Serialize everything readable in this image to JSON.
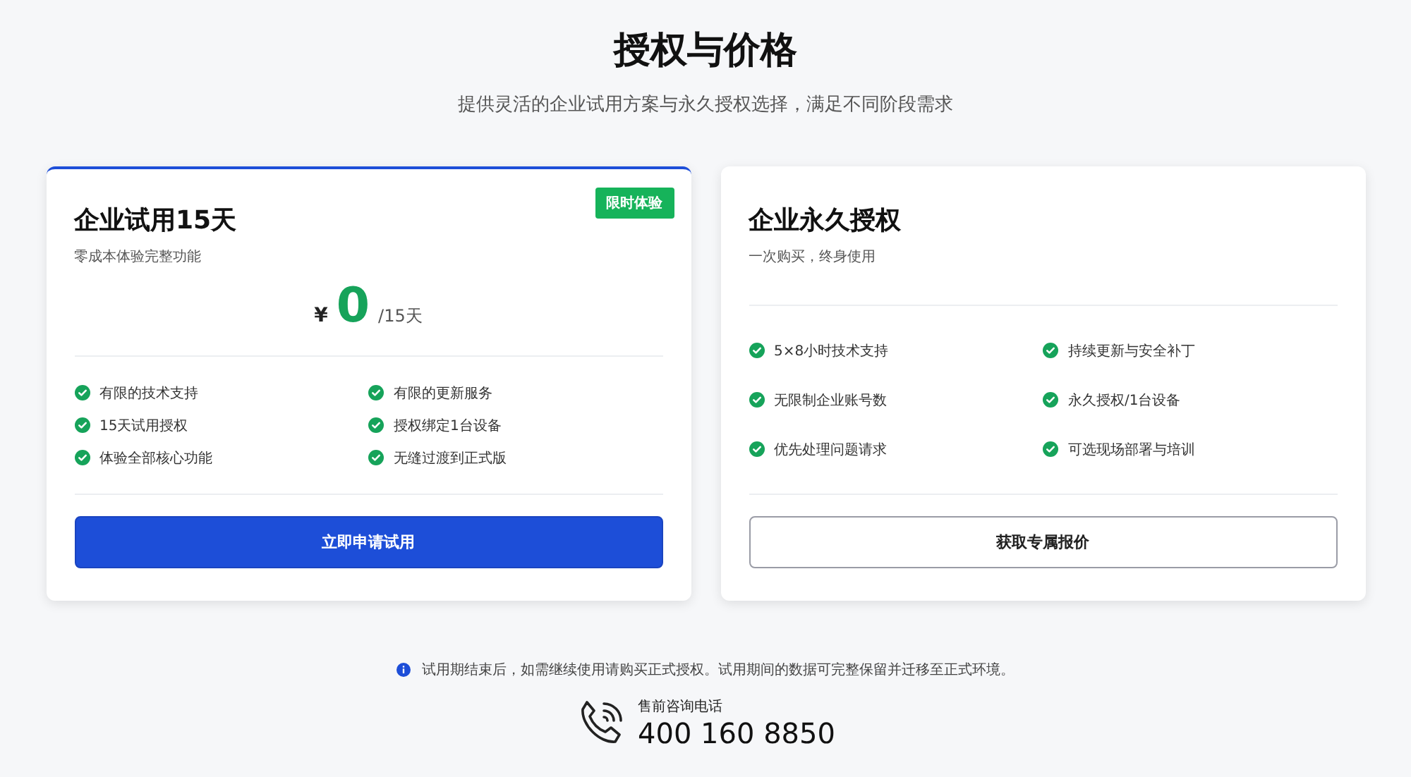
{
  "header": {
    "title": "授权与价格",
    "subtitle": "提供灵活的企业试用方案与永久授权选择，满足不同阶段需求"
  },
  "plans": [
    {
      "kind": "trial",
      "highlighted": true,
      "badge": "限时体验",
      "title": "企业试用15天",
      "subtitle": "零成本体验完整功能",
      "price": {
        "currency": "¥",
        "amount": "0",
        "period": "/15天"
      },
      "features": [
        "有限的技术支持",
        "有限的更新服务",
        "15天试用授权",
        "授权绑定1台设备",
        "体验全部核心功能",
        "无缝过渡到正式版"
      ],
      "button": {
        "label": "立即申请试用"
      }
    },
    {
      "kind": "perpetual",
      "highlighted": false,
      "title": "企业永久授权",
      "subtitle": "一次购买，终身使用",
      "features": [
        "5×8小时技术支持",
        "持续更新与安全补丁",
        "无限制企业账号数",
        "永久授权/1台设备",
        "优先处理问题请求",
        "可选现场部署与培训"
      ],
      "button": {
        "label": "获取专属报价"
      }
    }
  ],
  "notice": "试用期结束后，如需继续使用请购买正式授权。试用期间的数据可完整保留并迁移至正式环境。",
  "contact": {
    "label": "售前咨询电话",
    "phone": "400 160 8850"
  }
}
